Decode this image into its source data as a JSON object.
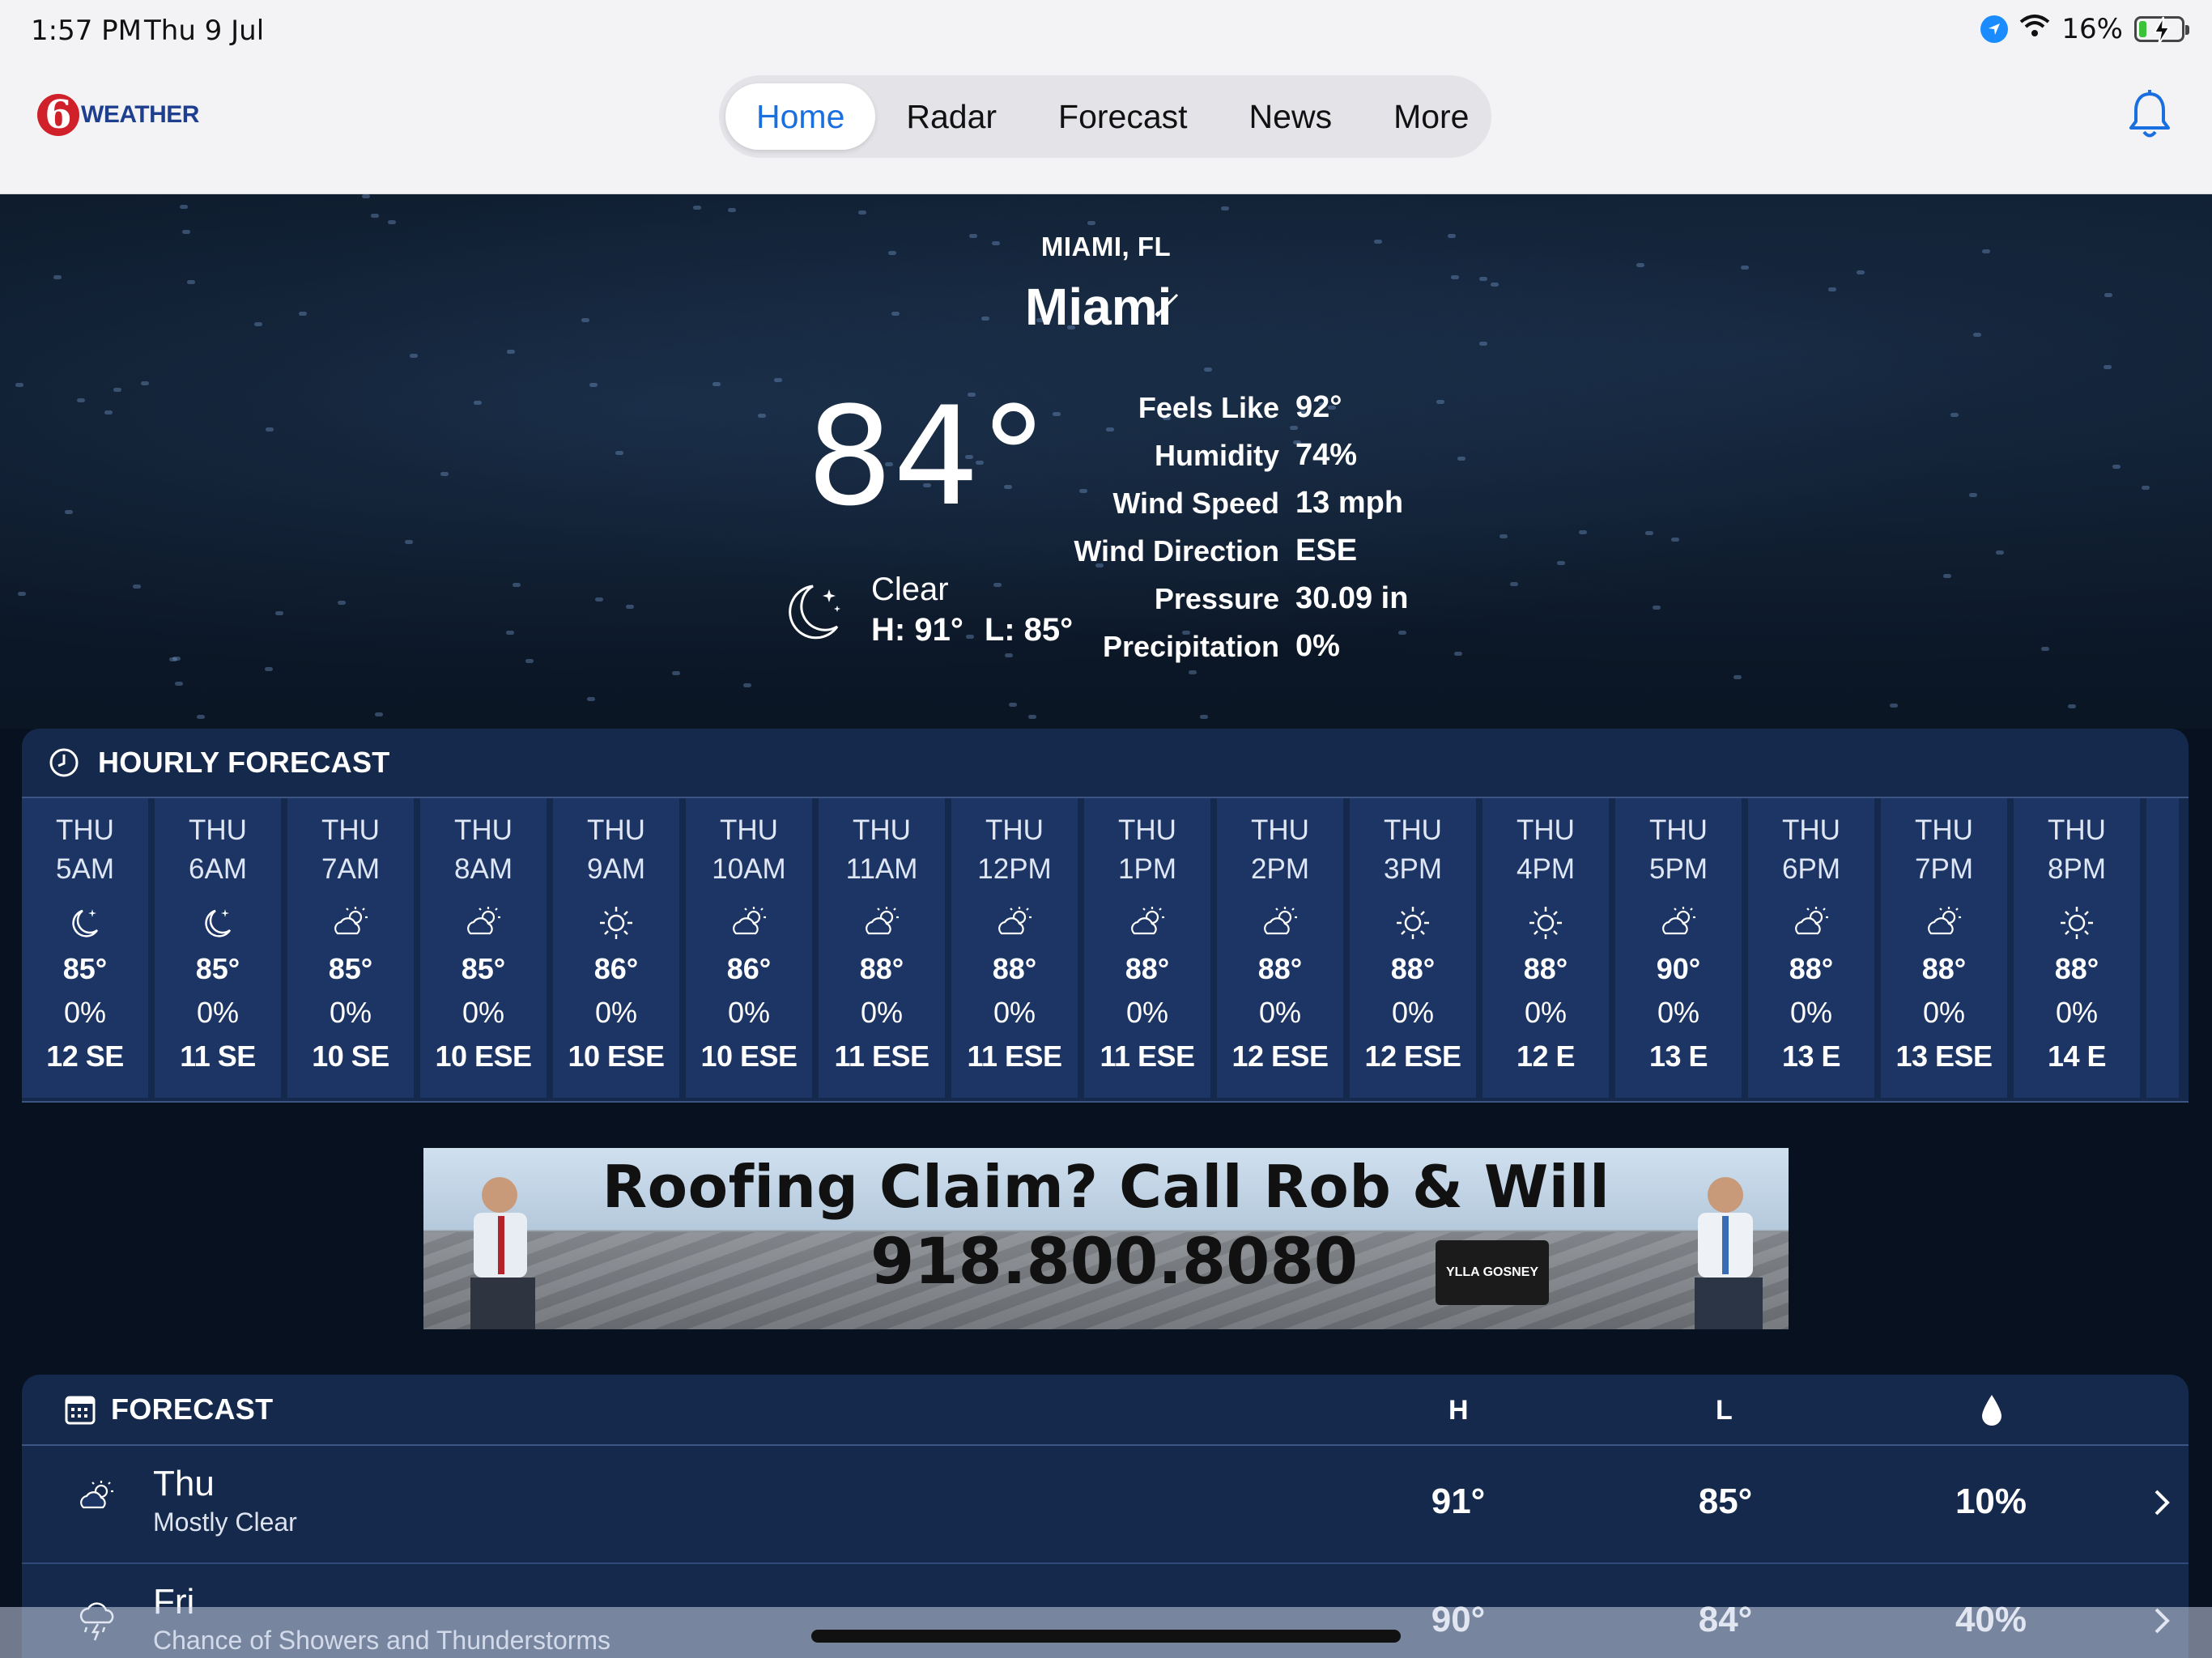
{
  "status_bar": {
    "time": "1:57 PM",
    "date": "Thu 9 Jul",
    "battery": "16%",
    "battery_level": 0.16
  },
  "app": {
    "logo_six": "6",
    "logo_word": "WEATHER"
  },
  "nav": {
    "tabs": [
      "Home",
      "Radar",
      "Forecast",
      "News",
      "More"
    ],
    "active_tab": "Home"
  },
  "location": {
    "upper": "MIAMI, FL",
    "name": "Miami"
  },
  "current": {
    "temperature": "84°",
    "condition": "Clear",
    "high": "H: 91°",
    "low": "L: 85°",
    "details": [
      {
        "label": "Feels Like",
        "value": "92°"
      },
      {
        "label": "Humidity",
        "value": "74%"
      },
      {
        "label": "Wind Speed",
        "value": "13 mph"
      },
      {
        "label": "Wind Direction",
        "value": "ESE"
      },
      {
        "label": "Pressure",
        "value": "30.09 in"
      },
      {
        "label": "Precipitation",
        "value": "0%"
      }
    ]
  },
  "hourly": {
    "title": "HOURLY FORECAST",
    "hours": [
      {
        "day": "THU",
        "time": "5AM",
        "icon": "moon-clear-icon",
        "temp": "85°",
        "precip": "0%",
        "wind": "12 SE"
      },
      {
        "day": "THU",
        "time": "6AM",
        "icon": "moon-clear-icon",
        "temp": "85°",
        "precip": "0%",
        "wind": "11 SE"
      },
      {
        "day": "THU",
        "time": "7AM",
        "icon": "partly-cloudy-icon",
        "temp": "85°",
        "precip": "0%",
        "wind": "10 SE"
      },
      {
        "day": "THU",
        "time": "8AM",
        "icon": "partly-cloudy-icon",
        "temp": "85°",
        "precip": "0%",
        "wind": "10 ESE"
      },
      {
        "day": "THU",
        "time": "9AM",
        "icon": "sun-icon",
        "temp": "86°",
        "precip": "0%",
        "wind": "10 ESE"
      },
      {
        "day": "THU",
        "time": "10AM",
        "icon": "partly-cloudy-icon",
        "temp": "86°",
        "precip": "0%",
        "wind": "10 ESE"
      },
      {
        "day": "THU",
        "time": "11AM",
        "icon": "partly-cloudy-icon",
        "temp": "88°",
        "precip": "0%",
        "wind": "11 ESE"
      },
      {
        "day": "THU",
        "time": "12PM",
        "icon": "partly-cloudy-icon",
        "temp": "88°",
        "precip": "0%",
        "wind": "11 ESE"
      },
      {
        "day": "THU",
        "time": "1PM",
        "icon": "partly-cloudy-icon",
        "temp": "88°",
        "precip": "0%",
        "wind": "11 ESE"
      },
      {
        "day": "THU",
        "time": "2PM",
        "icon": "partly-cloudy-icon",
        "temp": "88°",
        "precip": "0%",
        "wind": "12 ESE"
      },
      {
        "day": "THU",
        "time": "3PM",
        "icon": "sun-icon",
        "temp": "88°",
        "precip": "0%",
        "wind": "12 ESE"
      },
      {
        "day": "THU",
        "time": "4PM",
        "icon": "sun-icon",
        "temp": "88°",
        "precip": "0%",
        "wind": "12 E"
      },
      {
        "day": "THU",
        "time": "5PM",
        "icon": "partly-cloudy-icon",
        "temp": "90°",
        "precip": "0%",
        "wind": "13 E"
      },
      {
        "day": "THU",
        "time": "6PM",
        "icon": "partly-cloudy-icon",
        "temp": "88°",
        "precip": "0%",
        "wind": "13 E"
      },
      {
        "day": "THU",
        "time": "7PM",
        "icon": "partly-cloudy-icon",
        "temp": "88°",
        "precip": "0%",
        "wind": "13 ESE"
      },
      {
        "day": "THU",
        "time": "8PM",
        "icon": "sun-icon",
        "temp": "88°",
        "precip": "0%",
        "wind": "14 E"
      }
    ]
  },
  "ad": {
    "line1": "Roofing Claim? Call Rob & Will",
    "line2": "918.800.8080",
    "badge": "YLLA GOSNEY"
  },
  "forecast": {
    "title": "FORECAST",
    "col_high": "H",
    "col_low": "L",
    "col_precip_icon": "raindrop-icon",
    "days": [
      {
        "name": "Thu",
        "desc": "Mostly Clear",
        "icon": "partly-cloudy-icon",
        "high": "91°",
        "low": "85°",
        "precip": "10%"
      },
      {
        "name": "Fri",
        "desc": "Chance of Showers and Thunderstorms",
        "icon": "thunderstorm-icon",
        "high": "90°",
        "low": "84°",
        "precip": "40%"
      }
    ]
  }
}
